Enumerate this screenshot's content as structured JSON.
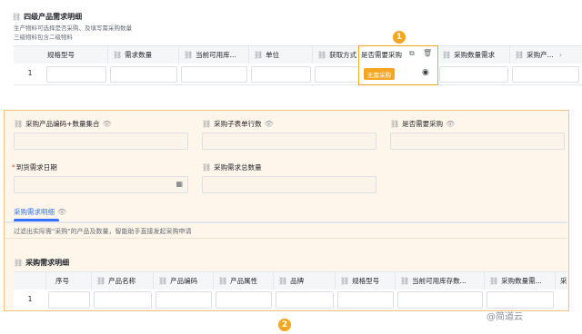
{
  "top_section": {
    "title": "四级产品需求明细",
    "hint_line1": "生产物料可选择是否采购、及填写需采购数量",
    "hint_line2": "三级物料包含二级物料",
    "columns": [
      "规格型号",
      "需求数量",
      "当前可用库...",
      "单位",
      "获取方式",
      "是否需要采购",
      "采购数量需求",
      "采购产..."
    ],
    "row_number": "1",
    "tag_button": "无需采购",
    "badge": "1"
  },
  "form": {
    "field1_label": "采购产品编码+数量集合",
    "field2_label": "采购子表单行数",
    "field3_label": "是否需要采购",
    "field4_label": "到货需求日期",
    "field4_required": "*",
    "field5_label": "采购需求总数量",
    "tab_label": "采购需求明细",
    "description": "过滤出实际需\"采购\"的产品及数量，智能助手直接发起采购申请",
    "subtable_title": "采购需求明细",
    "subtable_columns": [
      "序号",
      "产品名称",
      "产品编码",
      "产品属性",
      "品牌",
      "规格型号",
      "当前可用库存数...",
      "采购数量需...",
      "采"
    ],
    "row_number": "1"
  },
  "badge2": "2",
  "watermark": "@简道云",
  "colors": {
    "accent": "#f5a623",
    "highlight_bg": "#fef6ea",
    "tag_bg": "#f5a623",
    "link_blue": "#3370ff"
  }
}
